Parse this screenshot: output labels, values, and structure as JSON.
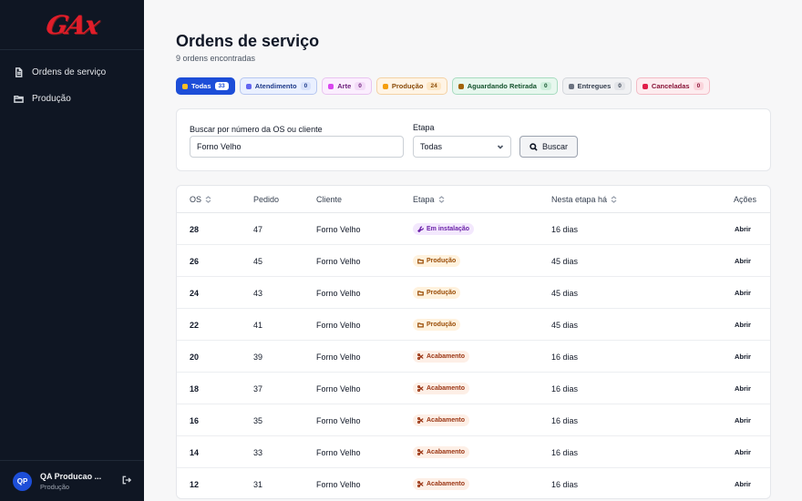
{
  "sidebar": {
    "logo": "GAx",
    "nav": [
      {
        "label": "Ordens de serviço",
        "icon": "document-icon"
      },
      {
        "label": "Produção",
        "icon": "folder-icon"
      }
    ],
    "user": {
      "initials": "QP",
      "name": "QA Producao ...",
      "role": "Produção"
    }
  },
  "header": {
    "title": "Ordens de serviço",
    "subtitle": "9 ordens encontradas"
  },
  "chips": [
    {
      "label": "Todas",
      "count": "33",
      "active": true,
      "bg": "#1d4ed8",
      "border": "#1d4ed8",
      "color": "#ffffff",
      "dot": "#fbbf24",
      "cntBg": "#ffffff",
      "cntColor": "#1d4ed8"
    },
    {
      "label": "Atendimento",
      "count": "0",
      "bg": "#eaf0ff",
      "border": "#b7c7f0",
      "color": "#1e3a8a",
      "dot": "#6366f1",
      "cntBg": "#d7e1fb",
      "cntColor": "#1e3a8a"
    },
    {
      "label": "Arte",
      "count": "0",
      "bg": "#fbeefe",
      "border": "#e9c4f0",
      "color": "#6b1d7a",
      "dot": "#d946ef",
      "cntBg": "#f3dbf8",
      "cntColor": "#6b1d7a"
    },
    {
      "label": "Produção",
      "count": "24",
      "bg": "#fff4e5",
      "border": "#f4d2a5",
      "color": "#8a4b08",
      "dot": "#f59e0b",
      "cntBg": "#fde7c5",
      "cntColor": "#8a4b08"
    },
    {
      "label": "Aguardando Retirada",
      "count": "0",
      "bg": "#e7f7ee",
      "border": "#a8dcc0",
      "color": "#14532d",
      "dot": "#a16207",
      "cntBg": "#cdeedb",
      "cntColor": "#14532d"
    },
    {
      "label": "Entregues",
      "count": "0",
      "bg": "#f0f1f3",
      "border": "#d4d7dc",
      "color": "#374151",
      "dot": "#6b7280",
      "cntBg": "#e2e4e8",
      "cntColor": "#374151"
    },
    {
      "label": "Canceladas",
      "count": "0",
      "bg": "#fdecef",
      "border": "#f3bcc6",
      "color": "#881337",
      "dot": "#e11d48",
      "cntBg": "#fad4db",
      "cntColor": "#881337"
    }
  ],
  "filters": {
    "search_label": "Buscar por número da OS ou cliente",
    "search_value": "Forno Velho",
    "stage_label": "Etapa",
    "stage_value": "Todas",
    "search_button": "Buscar"
  },
  "table": {
    "headers": {
      "os": "OS",
      "pedido": "Pedido",
      "cliente": "Cliente",
      "etapa": "Etapa",
      "nesta": "Nesta etapa há",
      "acoes": "Ações"
    },
    "open_label": "Abrir",
    "stages": {
      "instalacao": {
        "label": "Em instalação",
        "bg": "#f3e8fd",
        "color": "#6b21a8",
        "icon": "wrench-icon"
      },
      "producao": {
        "label": "Produção",
        "bg": "#fff2de",
        "color": "#9a4d07",
        "icon": "folder-icon"
      },
      "acabamento": {
        "label": "Acabamento",
        "bg": "#fdefe6",
        "color": "#9a3412",
        "icon": "scissors-icon"
      }
    },
    "rows": [
      {
        "os": "28",
        "pedido": "47",
        "cliente": "Forno Velho",
        "stage": "instalacao",
        "nesta": "16 dias"
      },
      {
        "os": "26",
        "pedido": "45",
        "cliente": "Forno Velho",
        "stage": "producao",
        "nesta": "45 dias"
      },
      {
        "os": "24",
        "pedido": "43",
        "cliente": "Forno Velho",
        "stage": "producao",
        "nesta": "45 dias"
      },
      {
        "os": "22",
        "pedido": "41",
        "cliente": "Forno Velho",
        "stage": "producao",
        "nesta": "45 dias"
      },
      {
        "os": "20",
        "pedido": "39",
        "cliente": "Forno Velho",
        "stage": "acabamento",
        "nesta": "16 dias"
      },
      {
        "os": "18",
        "pedido": "37",
        "cliente": "Forno Velho",
        "stage": "acabamento",
        "nesta": "16 dias"
      },
      {
        "os": "16",
        "pedido": "35",
        "cliente": "Forno Velho",
        "stage": "acabamento",
        "nesta": "16 dias"
      },
      {
        "os": "14",
        "pedido": "33",
        "cliente": "Forno Velho",
        "stage": "acabamento",
        "nesta": "16 dias"
      },
      {
        "os": "12",
        "pedido": "31",
        "cliente": "Forno Velho",
        "stage": "acabamento",
        "nesta": "16 dias"
      }
    ]
  }
}
